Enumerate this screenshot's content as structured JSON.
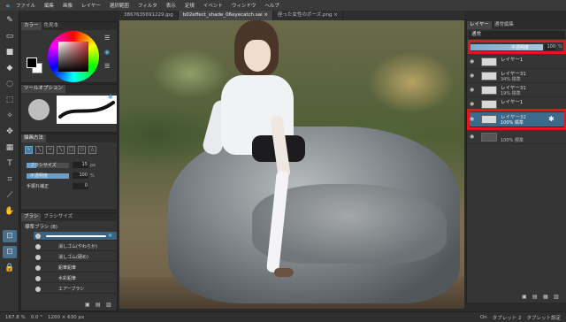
{
  "menu": {
    "logo": "«",
    "items": [
      "ファイル",
      "編集",
      "画像",
      "レイヤー",
      "選択範囲",
      "フィルタ",
      "表示",
      "定規",
      "イベント",
      "ウィンドウ",
      "ヘルプ"
    ]
  },
  "doc_tabs": [
    "3867635691229.jpg",
    "b02effect_shade_06eyecatch.sai ×",
    "座った女性のポーズ.png ×"
  ],
  "color_panel": {
    "tabs": [
      "カラー",
      "色見本"
    ],
    "fg_color": "#000000",
    "bg_color": "#ffffff"
  },
  "tool_option": {
    "title": "ツールオプション"
  },
  "brush_settings": {
    "title": "描画方法",
    "shapes": [
      "∿",
      "╲",
      "«",
      "╲",
      "□",
      "○",
      "△"
    ],
    "size_label": "ブラシサイズ",
    "size_value": "15",
    "size_unit": "px",
    "size_fill": 0.22,
    "opacity_label": "不透明度",
    "opacity_value": "100",
    "opacity_unit": "%",
    "opacity_fill": 1.0,
    "stabilizer_label": "手振れ補正",
    "stabilizer_value": "0"
  },
  "brush_list": {
    "tabs": [
      "ブラシ",
      "ブラシサイズ"
    ],
    "group": "標準ブラシ (8)",
    "items": [
      {
        "name": ""
      },
      {
        "name": "消しゴム(やわらか)"
      },
      {
        "name": "消しゴム(硬め)"
      },
      {
        "name": "鉛筆鉛筆"
      },
      {
        "name": "水彩鉛筆"
      },
      {
        "name": "エアーブラシ"
      }
    ]
  },
  "layers": {
    "tabs": [
      "レイヤー",
      "通常編集"
    ],
    "blend_mode": "通常",
    "opacity_label": "不透明度",
    "opacity_value": "100",
    "opacity_unit": "%",
    "items": [
      {
        "name": "レイヤー1",
        "mode": ""
      },
      {
        "name": "レイヤー31",
        "mode": "34% 標準"
      },
      {
        "name": "レイヤー31",
        "mode": "19% 標準"
      },
      {
        "name": "レイヤー1",
        "mode": ""
      },
      {
        "name": "レイヤー32",
        "mode": "100% 標準"
      },
      {
        "name": "",
        "mode": "100% 標準"
      }
    ]
  },
  "status": {
    "zoom": "167.8 %",
    "rotation": "0.0 °",
    "canvas_size": "1200 × 630 px",
    "on": "On",
    "tablet": "タブレット 2",
    "tablet_settings": "タブレット設定"
  }
}
